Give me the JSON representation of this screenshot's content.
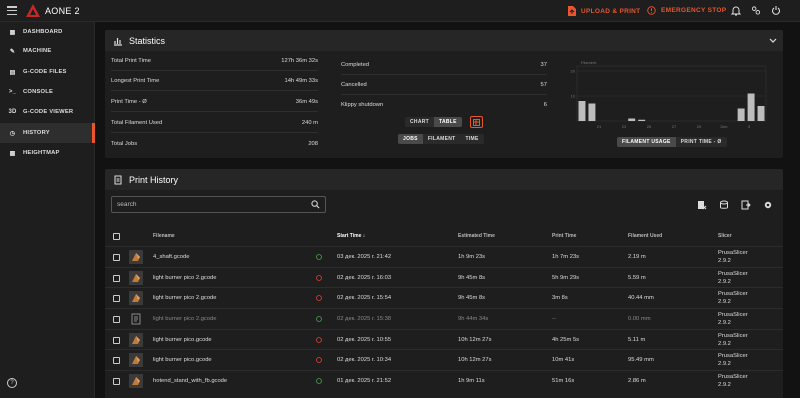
{
  "app": {
    "title": "AONE 2"
  },
  "topbar": {
    "upload_label": "UPLOAD & PRINT",
    "emergency_label": "EMERGENCY STOP",
    "accent": "#e8552e"
  },
  "sidebar": {
    "items": [
      {
        "label": "DASHBOARD",
        "icon": "dashboard-icon"
      },
      {
        "label": "MACHINE",
        "icon": "wrench-icon"
      },
      {
        "label": "G-CODE FILES",
        "icon": "file-icon"
      },
      {
        "label": "CONSOLE",
        "icon": "console-icon"
      },
      {
        "label": "G-CODE VIEWER",
        "icon": "3d-viewer-icon",
        "glyph": "3D"
      },
      {
        "label": "HISTORY",
        "icon": "history-icon",
        "active": true
      },
      {
        "label": "HEIGHTMAP",
        "icon": "grid-icon"
      }
    ]
  },
  "statistics": {
    "title": "Statistics",
    "left": [
      {
        "label": "Total Print Time",
        "value": "127h 36m 32s"
      },
      {
        "label": "Longest Print Time",
        "value": "14h 49m 33s"
      },
      {
        "label": "Print Time - Ø",
        "value": "36m 49s"
      },
      {
        "label": "Total Filament Used",
        "value": "240 m"
      },
      {
        "label": "Total Jobs",
        "value": "208"
      }
    ],
    "middle": [
      {
        "label": "Completed",
        "value": "37"
      },
      {
        "label": "Cancelled",
        "value": "57"
      },
      {
        "label": "Klippy shutdown",
        "value": "6"
      }
    ],
    "view_buttons": [
      "CHART",
      "TABLE"
    ],
    "group_buttons": [
      "JOBS",
      "FILAMENT",
      "TIME"
    ],
    "chart_buttons": [
      "FILAMENT USAGE",
      "PRINT TIME - Ø"
    ]
  },
  "chart_data": {
    "type": "bar",
    "series": [
      {
        "name": "Filament",
        "values": [
          8,
          7,
          0,
          0,
          0,
          1,
          0.5,
          0,
          0,
          0,
          0,
          0,
          0,
          0,
          0,
          0,
          5,
          11,
          6
        ]
      }
    ],
    "x_ticks": [
      "21",
      "23",
      "25",
      "27",
      "29",
      "Dec",
      "3"
    ],
    "y_ticks": [
      "20",
      "10"
    ],
    "ylim": [
      0,
      22
    ],
    "bar_color": "#bdbdbd"
  },
  "history": {
    "title": "Print History",
    "search_placeholder": "search",
    "columns": [
      "Filename",
      "Start Time",
      "Estimated Time",
      "Print Time",
      "Filament Used",
      "Slicer"
    ],
    "rows": [
      {
        "filename": "4_shaft.gcode",
        "status": "completed",
        "start": "03 дек. 2025 г. 21:42",
        "est": "1h 9m 23s",
        "print": "1h 7m 23s",
        "filament": "2.19 m",
        "slicer": "PrusaSlicer",
        "version": "2.9.2",
        "dim": false
      },
      {
        "filename": "light burner pico 2.gcode",
        "status": "cancelled",
        "start": "02 дек. 2025 г. 16:03",
        "est": "9h 45m 8s",
        "print": "5h 9m 29s",
        "filament": "5.59 m",
        "slicer": "PrusaSlicer",
        "version": "2.9.2",
        "dim": false
      },
      {
        "filename": "light burner pico 2.gcode",
        "status": "cancelled",
        "start": "02 дек. 2025 г. 15:54",
        "est": "9h 45m 8s",
        "print": "3m 8s",
        "filament": "40.44 mm",
        "slicer": "PrusaSlicer",
        "version": "2.9.2",
        "dim": false
      },
      {
        "filename": "light burner pico 2.gcode",
        "status": "completed",
        "start": "02 дек. 2025 г. 15:38",
        "est": "9h 44m 34s",
        "print": "--",
        "filament": "0.00 mm",
        "slicer": "PrusaSlicer",
        "version": "2.9.2",
        "dim": true
      },
      {
        "filename": "light burner pico.gcode",
        "status": "cancelled",
        "start": "02 дек. 2025 г. 10:55",
        "est": "10h 12m 27s",
        "print": "4h 25m 5s",
        "filament": "5.11 m",
        "slicer": "PrusaSlicer",
        "version": "2.9.2",
        "dim": false
      },
      {
        "filename": "light burner pico.gcode",
        "status": "cancelled",
        "start": "02 дек. 2025 г. 10:34",
        "est": "10h 12m 27s",
        "print": "10m 41s",
        "filament": "95.49 mm",
        "slicer": "PrusaSlicer",
        "version": "2.9.2",
        "dim": false
      },
      {
        "filename": "hotend_stand_with_fb.gcode",
        "status": "completed",
        "start": "01 дек. 2025 г. 21:52",
        "est": "1h 9m 11s",
        "print": "51m 16s",
        "filament": "2.86 m",
        "slicer": "PrusaSlicer",
        "version": "2.9.2",
        "dim": false
      }
    ]
  },
  "colors": {
    "ok": "#4caf50",
    "cancel": "#f44336"
  }
}
